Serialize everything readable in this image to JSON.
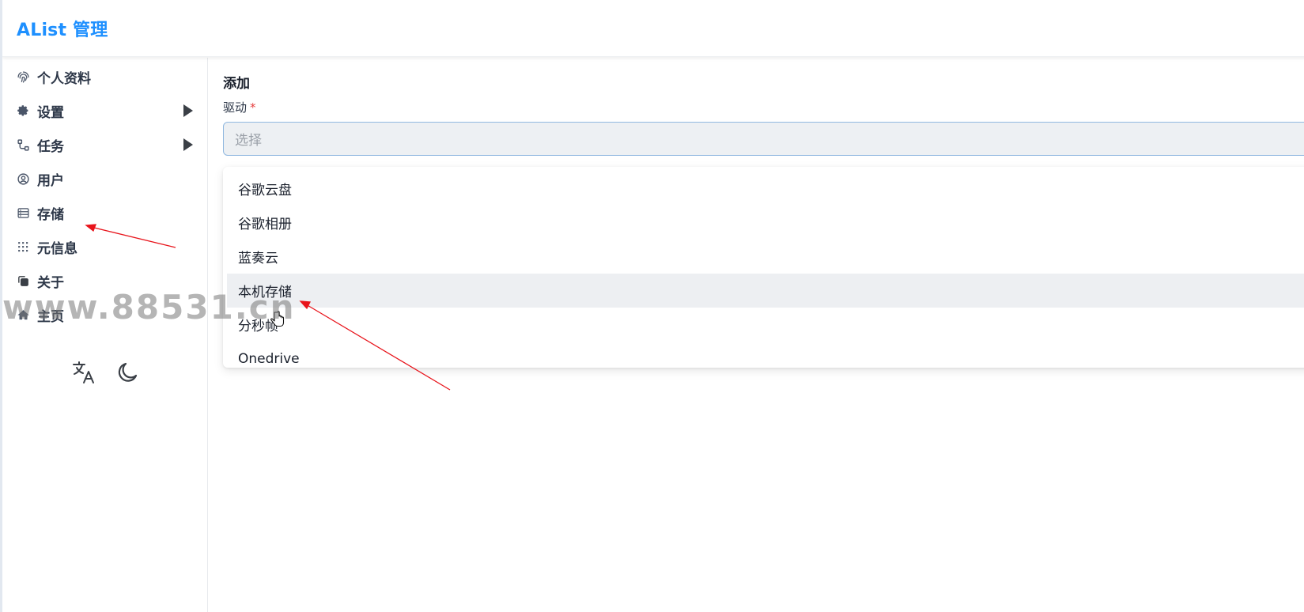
{
  "header": {
    "brand": "AList 管理"
  },
  "sidebar": {
    "items": [
      {
        "label": "个人资料",
        "icon": "fingerprint-icon"
      },
      {
        "label": "设置",
        "icon": "gear-icon",
        "has_submenu": true
      },
      {
        "label": "任务",
        "icon": "workflow-icon",
        "has_submenu": true
      },
      {
        "label": "用户",
        "icon": "user-circle-icon"
      },
      {
        "label": "存储",
        "icon": "storage-icon"
      },
      {
        "label": "元信息",
        "icon": "metadata-icon"
      },
      {
        "label": "关于",
        "icon": "copy-icon"
      },
      {
        "label": "主页",
        "icon": "home-icon"
      }
    ],
    "tools": [
      {
        "name": "language",
        "icon": "translate-icon"
      },
      {
        "name": "theme",
        "icon": "moon-icon"
      }
    ]
  },
  "form": {
    "title": "添加",
    "driver_label": "驱动",
    "required_mark": "*",
    "select_placeholder": "选择",
    "options": [
      "谷歌云盘",
      "谷歌相册",
      "蓝奏云",
      "本机存储",
      "分秒帧",
      "Onedrive"
    ],
    "highlighted_option": "本机存储"
  },
  "watermark": "www.88531.cn",
  "colors": {
    "brand": "#1e90ff",
    "required": "#e53e3e",
    "annotation_arrow": "#e8141b",
    "option_highlight": "#edeff2"
  }
}
